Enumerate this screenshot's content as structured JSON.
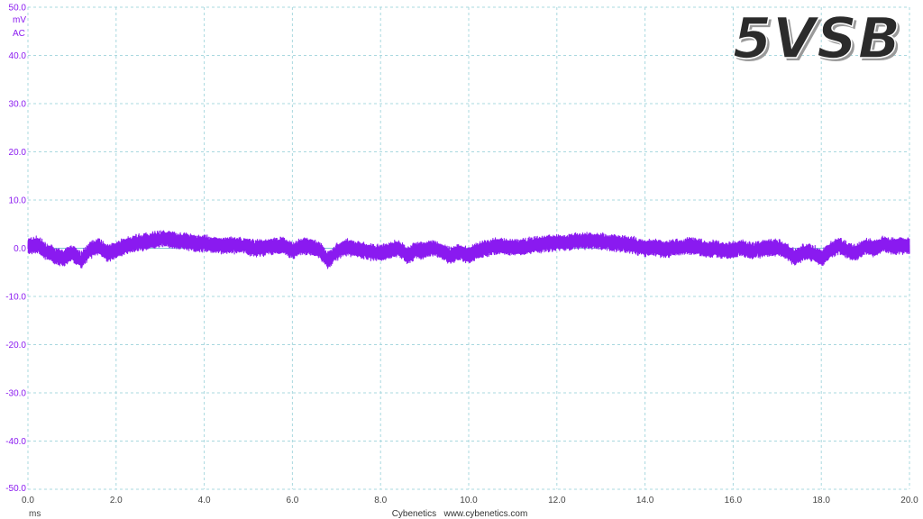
{
  "rail_label": "5VSB",
  "y_unit": "mV",
  "coupling": "AC",
  "x_unit": "ms",
  "credit": "Cybenetics   www.cybenetics.com",
  "colors": {
    "trace": "#8a1af0",
    "y_axis_text": "#8a1af0",
    "grid": "#a9d8df",
    "zero_line": "#7fc4cf",
    "title_fill": "#2b2b2b"
  },
  "chart_data": {
    "type": "line",
    "title": "5VSB",
    "xlabel": "ms",
    "ylabel": "mV",
    "xlim": [
      0,
      20
    ],
    "ylim": [
      -50,
      50
    ],
    "grid": true,
    "x_ticks": [
      "0.0",
      "2.0",
      "4.0",
      "6.0",
      "8.0",
      "10.0",
      "12.0",
      "14.0",
      "16.0",
      "18.0",
      "20.0"
    ],
    "y_ticks": [
      "50.0",
      "40.0",
      "30.0",
      "20.0",
      "10.0",
      "0.0",
      "-10.0",
      "-20.0",
      "-30.0",
      "-40.0",
      "-50.0"
    ],
    "series": [
      {
        "x": [
          0.0,
          0.2,
          0.4,
          0.6,
          0.8,
          1.0,
          1.2,
          1.4,
          1.6,
          1.8,
          2.0,
          2.2,
          2.4,
          2.6,
          2.8,
          3.0,
          3.2,
          3.4,
          3.6,
          3.8,
          4.0,
          4.2,
          4.4,
          4.6,
          4.8,
          5.0,
          5.2,
          5.4,
          5.6,
          5.8,
          6.0,
          6.2,
          6.4,
          6.6,
          6.8,
          7.0,
          7.2,
          7.4,
          7.6,
          7.8,
          8.0,
          8.2,
          8.4,
          8.6,
          8.8,
          9.0,
          9.2,
          9.4,
          9.6,
          9.8,
          10.0,
          10.2,
          10.4,
          10.6,
          10.8,
          11.0,
          11.2,
          11.4,
          11.6,
          11.8,
          12.0,
          12.2,
          12.4,
          12.6,
          12.8,
          13.0,
          13.2,
          13.4,
          13.6,
          13.8,
          14.0,
          14.2,
          14.4,
          14.6,
          14.8,
          15.0,
          15.2,
          15.4,
          15.6,
          15.8,
          16.0,
          16.2,
          16.4,
          16.6,
          16.8,
          17.0,
          17.2,
          17.4,
          17.6,
          17.8,
          18.0,
          18.2,
          18.4,
          18.6,
          18.8,
          19.0,
          19.2,
          19.4,
          19.6,
          19.8,
          20.0
        ],
        "y": [
          0.5,
          0.8,
          -0.5,
          -1.5,
          -2.0,
          -1.0,
          -2.5,
          -0.5,
          0.5,
          -1.0,
          -0.5,
          0.5,
          1.0,
          1.2,
          1.5,
          2.0,
          1.8,
          1.5,
          1.3,
          1.0,
          1.0,
          0.8,
          0.5,
          0.6,
          0.7,
          0.3,
          0.0,
          0.2,
          0.5,
          0.6,
          -0.5,
          0.5,
          0.3,
          -0.2,
          -2.5,
          -0.8,
          0.2,
          0.0,
          -0.5,
          -0.8,
          -1.0,
          -0.5,
          0.0,
          -1.5,
          -0.5,
          -0.5,
          0.2,
          -0.8,
          -1.5,
          -0.8,
          -1.5,
          -0.5,
          0.0,
          0.5,
          0.3,
          0.2,
          0.4,
          0.5,
          0.8,
          1.0,
          1.2,
          1.2,
          1.4,
          1.5,
          1.5,
          1.4,
          1.2,
          1.0,
          0.8,
          0.5,
          0.0,
          0.2,
          -0.3,
          0.0,
          0.2,
          0.5,
          0.3,
          -0.2,
          0.0,
          -0.5,
          -0.3,
          0.0,
          -0.5,
          -0.2,
          0.0,
          0.2,
          -0.5,
          -2.0,
          -0.8,
          -1.0,
          -2.0,
          -0.5,
          0.5,
          -0.5,
          -1.0,
          0.5,
          0.0,
          0.8,
          0.4,
          0.6,
          0.5
        ],
        "amplitude_mv": 1.6
      }
    ]
  }
}
